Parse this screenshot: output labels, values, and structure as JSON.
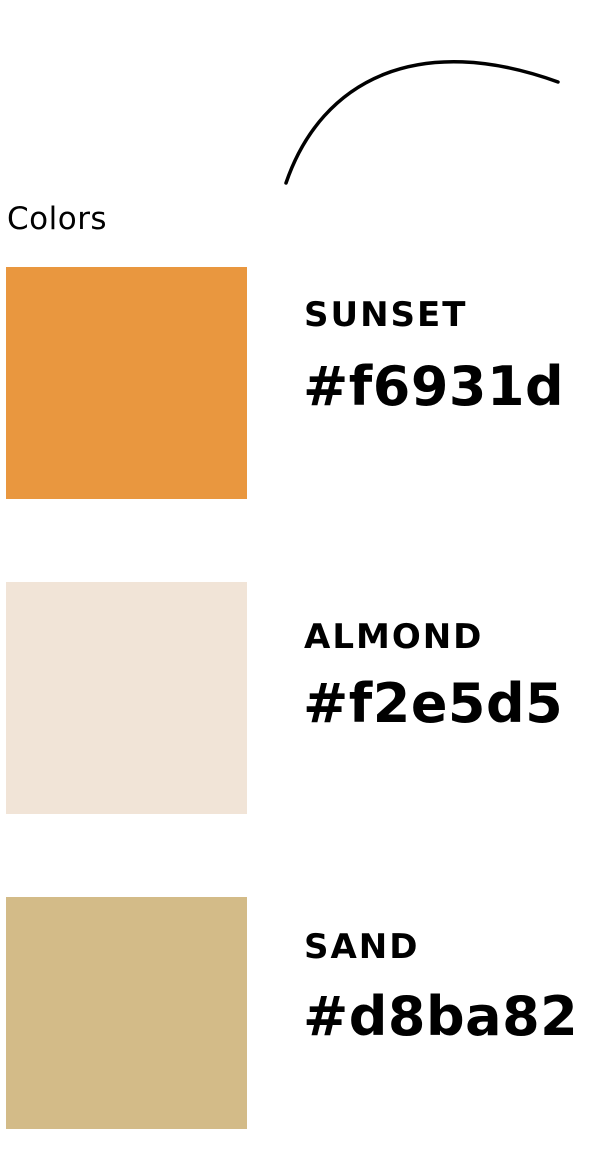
{
  "section": {
    "title": "Colors"
  },
  "swatches": [
    {
      "name": "SUNSET",
      "hex_label": "#f6931d",
      "color": "#e9973f"
    },
    {
      "name": "ALMOND",
      "hex_label": "#f2e5d5",
      "color": "#f1e4d7"
    },
    {
      "name": "SAND",
      "hex_label": "#d8ba82",
      "color": "#d3bb88"
    }
  ]
}
